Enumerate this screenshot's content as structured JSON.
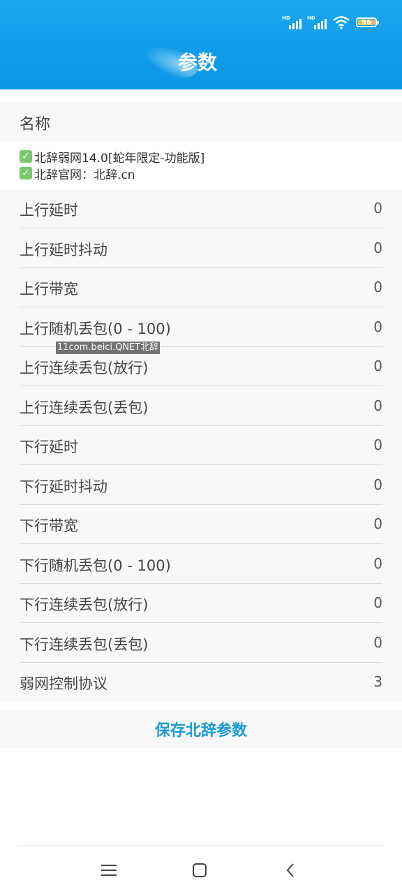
{
  "status_bar": {
    "signal1_label": "HD",
    "signal2_label": "HD",
    "battery_level": "96",
    "battery_color": "#e3c15a"
  },
  "header": {
    "title": "参数",
    "background": "#0b95e6"
  },
  "name_section": {
    "label": "名称"
  },
  "info_lines": [
    "北辞弱网14.0[蛇年限定-功能版]",
    "北辞官网：北辞.cn"
  ],
  "params": [
    {
      "label": "上行延时",
      "value": "0"
    },
    {
      "label": "上行延时抖动",
      "value": "0"
    },
    {
      "label": "上行带宽",
      "value": "0"
    },
    {
      "label": "上行随机丢包(0 - 100)",
      "value": "0"
    },
    {
      "label": "上行连续丢包(放行)",
      "value": "0"
    },
    {
      "label": "上行连续丢包(丢包)",
      "value": "0"
    },
    {
      "label": "下行延时",
      "value": "0"
    },
    {
      "label": "下行延时抖动",
      "value": "0"
    },
    {
      "label": "下行带宽",
      "value": "0"
    },
    {
      "label": "下行随机丢包(0 - 100)",
      "value": "0"
    },
    {
      "label": "下行连续丢包(放行)",
      "value": "0"
    },
    {
      "label": "下行连续丢包(丢包)",
      "value": "0"
    },
    {
      "label": "弱网控制协议",
      "value": "3"
    }
  ],
  "watermark": "11com.beici.QNET北辞",
  "save_button": {
    "label": "保存北辞参数",
    "color": "#1a9ad6"
  },
  "nav": {
    "menu_icon": "menu-icon",
    "home_icon": "home-icon",
    "back_icon": "back-icon"
  }
}
